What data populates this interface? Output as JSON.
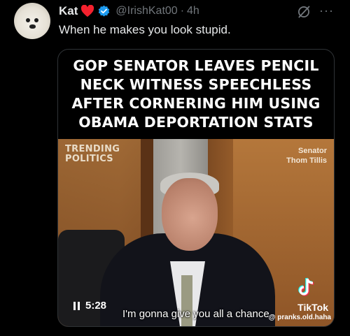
{
  "tweet": {
    "author_name": "Kat",
    "handle": "@IrishKat00",
    "separator": "·",
    "time": "4h",
    "text": "When he makes you look stupid.",
    "more": "···"
  },
  "media": {
    "headline_lines": [
      "GOP SENATOR LEAVES PENCIL",
      "NECK WITNESS SPEECHLESS",
      "AFTER CORNERING HIM USING",
      "OBAMA DEPORTATION STATS"
    ],
    "watermark_logo": [
      "TRENDING",
      "POLITICS"
    ],
    "name_tag": [
      "Senator",
      "Thom Tillis"
    ],
    "tiktok_label": "TikTok",
    "tiktok_handle": "@ pranks.old.haha",
    "duration": "5:28",
    "subtitle": "I'm gonna give you all a chance"
  },
  "colors": {
    "background": "#000000",
    "text": "#e7e9ea",
    "muted": "#71767b",
    "verified": "#1d9bf0",
    "heart": "#f4212e"
  },
  "icons": {
    "heart": "heart-icon",
    "verified": "verified-badge-icon",
    "grok": "grok-icon",
    "more": "more-icon",
    "pause": "pause-icon",
    "tiktok": "tiktok-icon"
  }
}
